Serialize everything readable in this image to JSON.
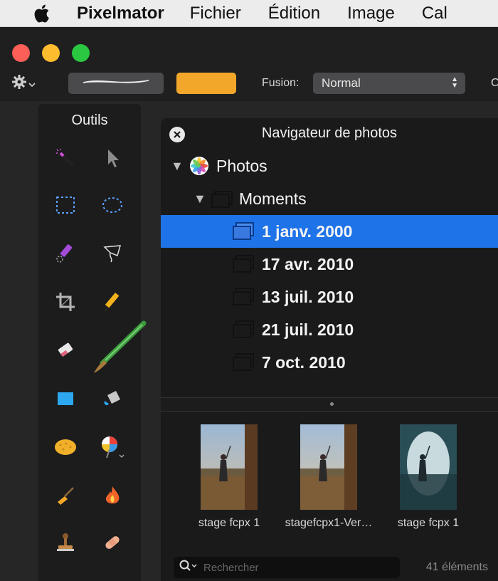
{
  "menubar": {
    "app_name": "Pixelmator",
    "items": [
      "Fichier",
      "Édition",
      "Image",
      "Cal"
    ]
  },
  "toolbar": {
    "fusion_label": "Fusion:",
    "fusion_value": "Normal",
    "truncated_label": "C",
    "color": "#f2a72a"
  },
  "tools": {
    "title": "Outils"
  },
  "navigator": {
    "title": "Navigateur de photos",
    "root_label": "Photos",
    "moments_label": "Moments",
    "moments": [
      "1 janv. 2000",
      "17 avr. 2010",
      "13 juil. 2010",
      "21 juil. 2010",
      "7 oct. 2010"
    ],
    "selected_index": 0,
    "thumbnails": [
      {
        "label": "stage fcpx 1"
      },
      {
        "label": "stagefcpx1-Ver…"
      },
      {
        "label": "stage fcpx 1"
      }
    ],
    "search_placeholder": "Rechercher",
    "count": "41 éléments"
  },
  "colors": {
    "selection": "#1e73e8",
    "accent_orange": "#f2a72a"
  }
}
